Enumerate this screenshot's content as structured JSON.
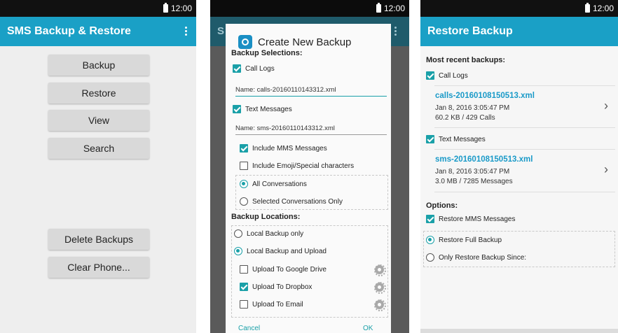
{
  "time": "12:00",
  "screen1": {
    "title": "SMS Backup & Restore",
    "buttons": [
      "Backup",
      "Restore",
      "View",
      "Search"
    ],
    "bottom_buttons": [
      "Delete Backups",
      "Clear Phone..."
    ],
    "partial_title_letter": "S"
  },
  "screen2": {
    "dialog_title": "Create New Backup",
    "backup_selections": "Backup Selections:",
    "call_logs": "Call Logs",
    "calls_name": "Name: calls-20160110143312.xml",
    "text_messages": "Text Messages",
    "sms_name": "Name: sms-20160110143312.xml",
    "include_mms": "Include MMS Messages",
    "include_emoji": "Include Emoji/Special characters",
    "all_conversations": "All Conversations",
    "selected_conversations": "Selected Conversations Only",
    "backup_locations": "Backup Locations:",
    "local_only": "Local Backup only",
    "local_upload": "Local Backup and Upload",
    "google_drive": "Upload To Google Drive",
    "dropbox": "Upload To Dropbox",
    "email": "Upload To Email",
    "cancel": "Cancel",
    "ok": "OK"
  },
  "screen3": {
    "title": "Restore Backup",
    "most_recent": "Most recent backups:",
    "call_logs": "Call Logs",
    "calls_file": "calls-20160108150513.xml",
    "calls_date": "Jan 8, 2016 3:05:47 PM",
    "calls_size": "60.2 KB / 429 Calls",
    "text_messages": "Text Messages",
    "sms_file": "sms-20160108150513.xml",
    "sms_date": "Jan 8, 2016 3:05:47 PM",
    "sms_size": "3.0 MB / 7285 Messages",
    "options": "Options:",
    "restore_mms": "Restore MMS Messages",
    "restore_full": "Restore Full Backup",
    "restore_since": "Only Restore Backup Since:",
    "chevron": "›"
  },
  "colors": {
    "accent": "#1aa0c6",
    "teal": "#1aa0a8"
  }
}
